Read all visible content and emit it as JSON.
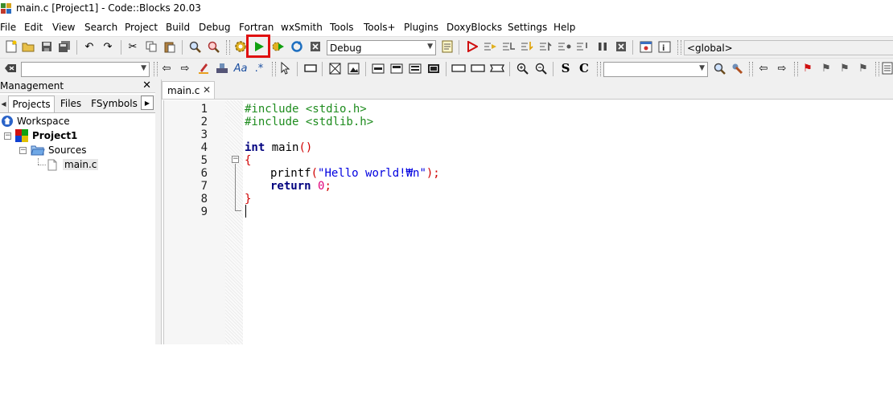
{
  "window": {
    "title": "main.c [Project1] - Code::Blocks 20.03",
    "app_icon": "codeblocks-icon"
  },
  "menu": [
    "File",
    "Edit",
    "View",
    "Search",
    "Project",
    "Build",
    "Debug",
    "Fortran",
    "wxSmith",
    "Tools",
    "Tools+",
    "Plugins",
    "DoxyBlocks",
    "Settings",
    "Help"
  ],
  "toolbar": {
    "build_target": "Debug",
    "scope": "<global>",
    "highlight_color": "#e01010"
  },
  "management": {
    "title": "Management",
    "close": "✕",
    "tabs": [
      "Projects",
      "Files",
      "FSymbols"
    ],
    "tree": {
      "workspace": "Workspace",
      "project": "Project1",
      "folder": "Sources",
      "file": "main.c"
    }
  },
  "editor": {
    "tab": "main.c",
    "tab_close": "✕",
    "line_numbers": [
      "1",
      "2",
      "3",
      "4",
      "5",
      "6",
      "7",
      "8",
      "9"
    ],
    "lines": {
      "l1": "#include <stdio.h>",
      "l2": "#include <stdlib.h>",
      "l4_kw": "int",
      "l4_rest": " main",
      "l4_par": "()",
      "l5": "{",
      "l6_fn": "printf",
      "l6_open": "(",
      "l6_str": "\"Hello world!₩n\"",
      "l6_close": ");",
      "l7_kw": "return",
      "l7_num": "0",
      "l7_semi": ";",
      "l8": "}"
    }
  }
}
